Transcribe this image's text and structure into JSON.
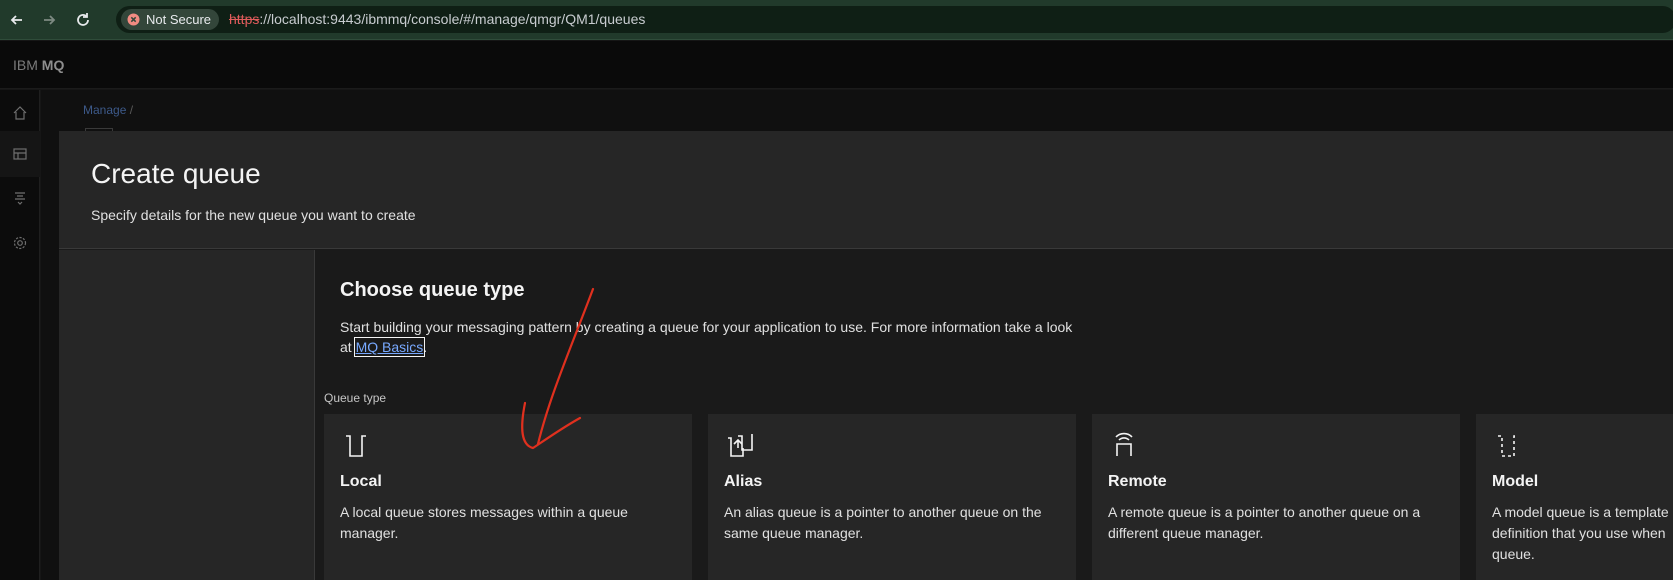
{
  "browser": {
    "url_scheme": "https",
    "url_rest": "://localhost:9443/ibmmq/console/#/manage/qmgr/QM1/queues",
    "security_label": "Not Secure"
  },
  "app": {
    "brand_prefix": "IBM ",
    "brand_bold": "MQ"
  },
  "rail": [
    "home-icon",
    "table-icon",
    "queue-manager-icon",
    "gear-icon"
  ],
  "breadcrumb": {
    "item": "Manage",
    "separator": "/"
  },
  "modal": {
    "title": "Create queue",
    "description": "Specify details for the new queue you want to create"
  },
  "section": {
    "title": "Choose queue type",
    "description_before": "Start building your messaging pattern by creating a queue for your application to use. For more information take a look at ",
    "link": "MQ Basics",
    "description_after": ".",
    "queue_type_label": "Queue type"
  },
  "tiles": [
    {
      "title": "Local",
      "description": "A local queue stores messages within a queue manager.",
      "icon": "local-queue-icon"
    },
    {
      "title": "Alias",
      "description": "An alias queue is a pointer to another queue on the same queue manager.",
      "icon": "alias-queue-icon"
    },
    {
      "title": "Remote",
      "description": "A remote queue is a pointer to another queue on a different queue manager.",
      "icon": "remote-queue-icon"
    },
    {
      "title": "Model",
      "description": "A model queue is a template definition that you use when queue.",
      "icon": "model-queue-icon"
    }
  ],
  "colors": {
    "annotation_arrow": "#e0301e",
    "link": "#78a9ff"
  }
}
